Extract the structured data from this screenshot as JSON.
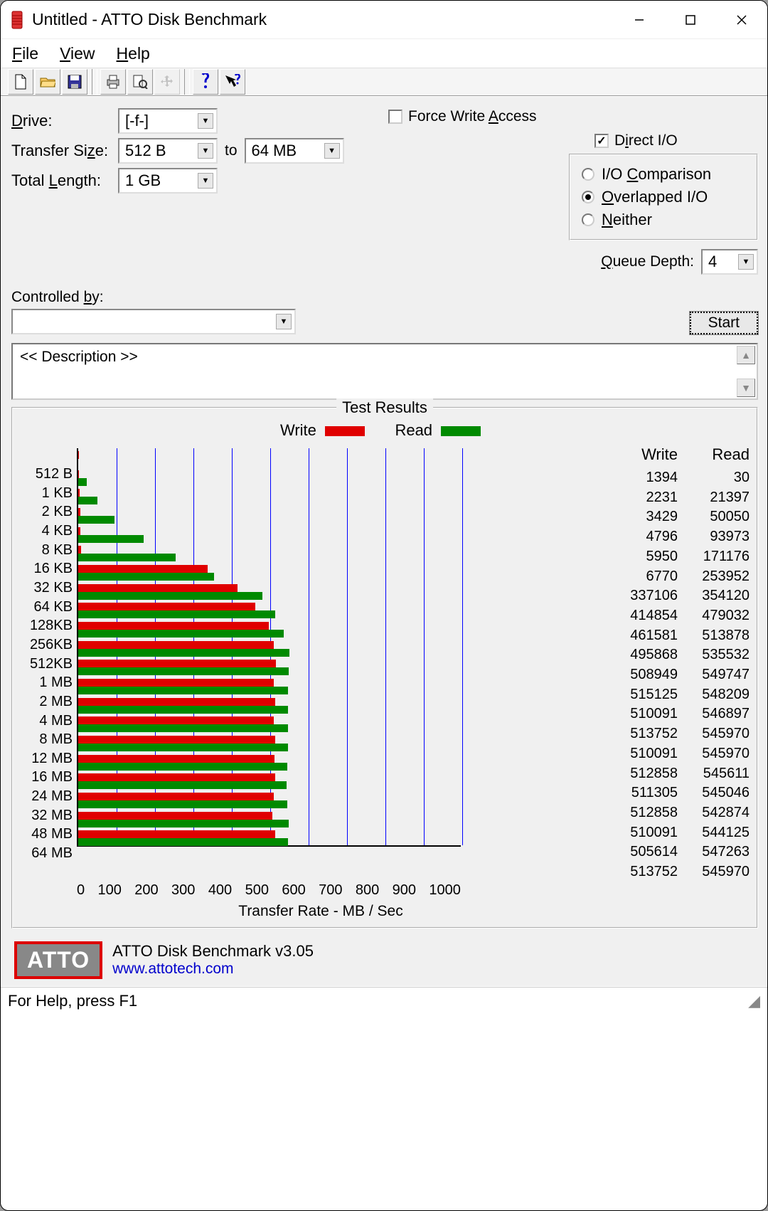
{
  "window": {
    "title": "Untitled - ATTO Disk Benchmark"
  },
  "menu": {
    "file": "File",
    "view": "View",
    "help": "Help"
  },
  "config": {
    "drive_label": "Drive:",
    "drive_value": "[-f-]",
    "transfer_size_label": "Transfer Size:",
    "transfer_from": "512 B",
    "transfer_to_label": "to",
    "transfer_to": "64 MB",
    "total_length_label": "Total Length:",
    "total_length": "1 GB",
    "force_write": "Force Write Access",
    "direct_io": "Direct I/O",
    "io_comparison": "I/O Comparison",
    "overlapped_io": "Overlapped I/O",
    "neither": "Neither",
    "queue_depth_label": "Queue Depth:",
    "queue_depth": "4",
    "controlled_by": "Controlled by:",
    "start": "Start",
    "description": "<< Description >>"
  },
  "results": {
    "title": "Test Results",
    "legend_write": "Write",
    "legend_read": "Read",
    "col_write": "Write",
    "col_read": "Read",
    "xlabel": "Transfer Rate - MB / Sec"
  },
  "chart_data": {
    "type": "bar",
    "xlim": [
      0,
      1000
    ],
    "xticks": [
      0,
      100,
      200,
      300,
      400,
      500,
      600,
      700,
      800,
      900,
      1000
    ],
    "xlabel": "Transfer Rate - MB / Sec",
    "series": [
      {
        "name": "Write",
        "color": "#e00000",
        "unit": "KB/s",
        "values": [
          1394,
          2231,
          3429,
          4796,
          5950,
          6770,
          337106,
          414854,
          461581,
          495868,
          508949,
          515125,
          510091,
          513752,
          510091,
          512858,
          511305,
          512858,
          510091,
          505614,
          513752
        ]
      },
      {
        "name": "Read",
        "color": "#008a00",
        "unit": "KB/s",
        "values": [
          30,
          21397,
          50050,
          93973,
          171176,
          253952,
          354120,
          479032,
          513878,
          535532,
          549747,
          548209,
          546897,
          545970,
          545970,
          545611,
          545046,
          542874,
          544125,
          547263,
          545970
        ]
      }
    ],
    "categories": [
      "512 B",
      "1 KB",
      "2 KB",
      "4 KB",
      "8 KB",
      "16 KB",
      "32 KB",
      "64 KB",
      "128KB",
      "256KB",
      "512KB",
      "1 MB",
      "2 MB",
      "4 MB",
      "8 MB",
      "12 MB",
      "16 MB",
      "24 MB",
      "32 MB",
      "48 MB",
      "64 MB"
    ]
  },
  "footer": {
    "product": "ATTO Disk Benchmark v3.05",
    "url": "www.attotech.com",
    "logo": "ATTO"
  },
  "status": {
    "help": "For Help, press F1"
  }
}
